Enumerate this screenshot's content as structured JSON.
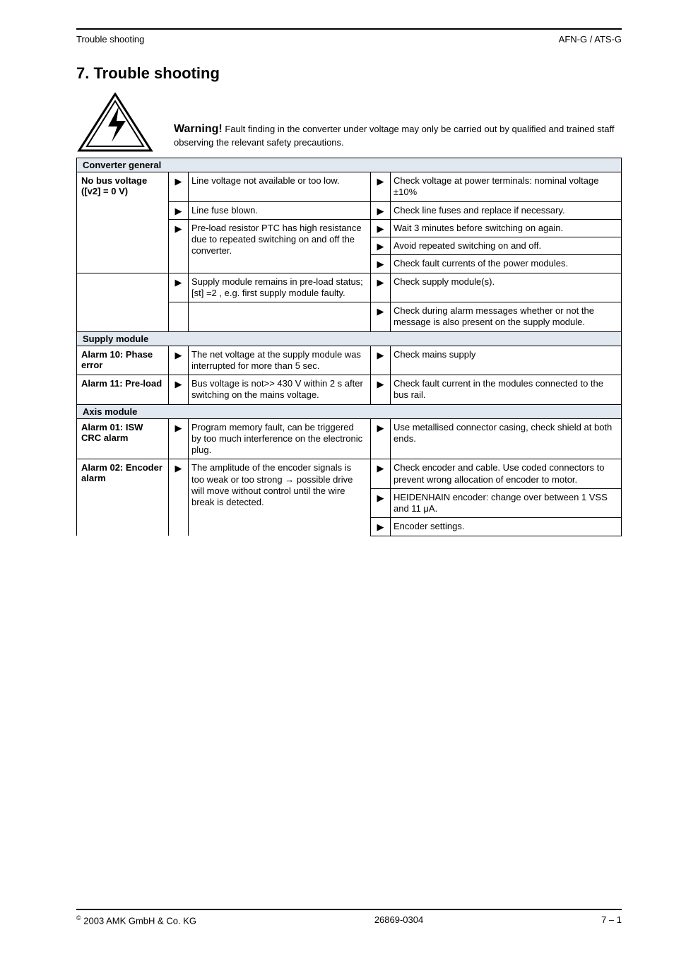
{
  "header": {
    "left": "Trouble shooting",
    "right": "AFN-G / ATS-G"
  },
  "title": "7. Trouble shooting",
  "warning": {
    "label": "Warning!",
    "text": "Fault finding in the converter under voltage may only be carried out by qualified and trained staff observing the relevant safety precautions."
  },
  "categories": [
    {
      "name": "Converter general",
      "rows": [
        {
          "fault": "No bus voltage ([v2] = 0 V)",
          "cause": "Line voltage not available or too low.",
          "remedies": [
            {
              "text": "Check voltage at power terminals: nominal voltage ±10%"
            }
          ]
        },
        {
          "fault": "",
          "cause": "Line fuse blown.",
          "remedies": [
            {
              "text": "Check line fuses and replace if necessary."
            }
          ]
        },
        {
          "fault": "",
          "cause": "Pre-load resistor PTC has high resistance due to repeated switching on and off the converter.",
          "remedies": [
            {
              "text": "Wait 3 minutes before switching on again."
            },
            {
              "text": "Avoid repeated switching on and off."
            },
            {
              "text": "Check fault currents of the power modules."
            }
          ]
        },
        {
          "fault": "",
          "cause": "Supply module remains in pre-load status; [st] =2 , e.g. first supply module faulty.",
          "remedies": [
            {
              "text": "Check supply module(s)."
            }
          ]
        },
        {
          "fault": "",
          "cause": "",
          "remedies": [
            {
              "text": "Check during alarm messages whether or not the message is also present on the supply module."
            }
          ]
        }
      ]
    },
    {
      "name": "Supply module",
      "rows": [
        {
          "fault": "Alarm 10: Phase error",
          "cause": "The net voltage at the supply module was interrupted for more than 5 sec.",
          "remedies": [
            {
              "text": "Check mains supply"
            }
          ]
        },
        {
          "fault": "Alarm 11: Pre-load",
          "cause": "Bus voltage is not>> 430 V within 2 s after switching on the mains voltage.",
          "remedies": [
            {
              "text": "Check fault current in the modules connected to the bus rail."
            }
          ]
        }
      ]
    },
    {
      "name": "Axis module",
      "rows": [
        {
          "fault": "Alarm 01: ISW CRC alarm",
          "cause": "Program memory fault, can be triggered by too much interference on the electronic plug.",
          "remedies": [
            {
              "text": "Use metallised connector casing, check shield at both ends."
            }
          ]
        },
        {
          "fault": "Alarm 02: Encoder alarm",
          "cause": "The amplitude of the encoder signals is too weak or too strong → possible drive will move without control until the wire break is detected.",
          "remedies": [
            {
              "text": "Check encoder and cable. Use coded connectors to prevent wrong allocation of encoder to motor."
            }
          ]
        },
        {
          "fault": "",
          "cause": "",
          "remedies": [
            {
              "text": "HEIDENHAIN encoder: change over between 1 VSS and 11 μA."
            }
          ]
        },
        {
          "fault": "",
          "cause": "",
          "remedies": [
            {
              "text": "Encoder settings."
            }
          ]
        }
      ]
    }
  ],
  "footer": {
    "left": "2003 AMK GmbH & Co. KG",
    "mid": "26869-0304",
    "right": "7 – 1"
  }
}
